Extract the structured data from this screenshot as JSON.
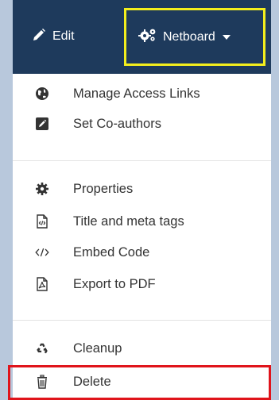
{
  "navbar": {
    "edit_label": "Edit",
    "netboard_label": "Netboard"
  },
  "menu": {
    "group1": [
      {
        "label": "Manage Access Links",
        "icon": "globe-icon"
      },
      {
        "label": "Set Co-authors",
        "icon": "edit-square-icon"
      }
    ],
    "group2": [
      {
        "label": "Properties",
        "icon": "gear-icon"
      },
      {
        "label": "Title and meta tags",
        "icon": "code-file-icon"
      },
      {
        "label": "Embed Code",
        "icon": "embed-code-icon"
      },
      {
        "label": "Export to PDF",
        "icon": "pdf-file-icon"
      }
    ],
    "group3": [
      {
        "label": "Cleanup",
        "icon": "recycle-icon"
      },
      {
        "label": "Delete",
        "icon": "trash-icon"
      }
    ]
  },
  "colors": {
    "navbar": "#1e3a5c",
    "highlight_yellow": "#f3ee1d",
    "highlight_red": "#e0141b",
    "background": "#b9c8da"
  }
}
